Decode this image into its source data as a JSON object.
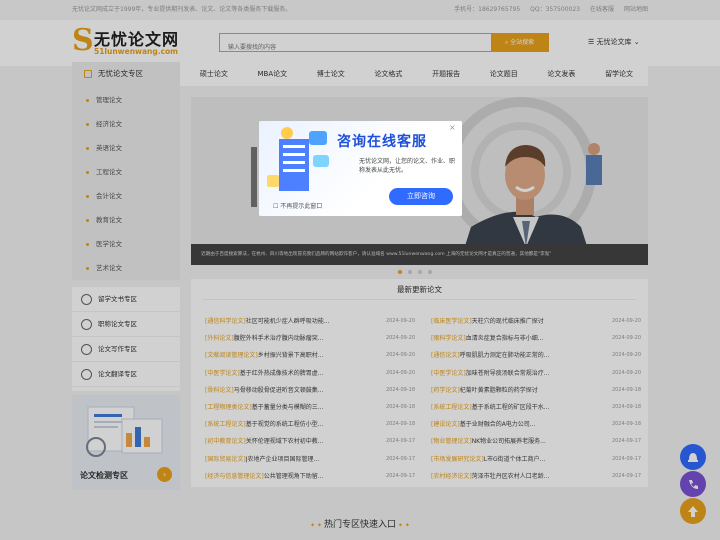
{
  "topbar": {
    "slogan": "无忧论文网成立于1999年，专业提供期刊发表、论文、论文等各类服务下载服务。",
    "phone": "手机号：18629765795",
    "qq": "QQ：357500023",
    "service": "在线客服",
    "home": "网站地图"
  },
  "logo": {
    "mark": "S",
    "name": "无忧论文网",
    "domain": "51lunwenwang.com"
  },
  "search": {
    "placeholder": "输入要搜找的内容",
    "button": "全站搜索"
  },
  "library": "无忧论文库",
  "nav": {
    "category": "无忧论文专区",
    "links": [
      "硕士论文",
      "MBA论文",
      "博士论文",
      "论文格式",
      "开题报告",
      "论文题目",
      "论文发表",
      "留学论文"
    ]
  },
  "sidebar": [
    "管理论文",
    "经济论文",
    "英语论文",
    "工程论文",
    "会计论文",
    "教育论文",
    "医学论文",
    "艺术论文"
  ],
  "zones": [
    "留学文书专区",
    "职称论文专区",
    "论文写作专区",
    "论文翻译专区"
  ],
  "detect": {
    "label": "论文检测专区",
    "go": "›"
  },
  "banner": {
    "ticker": "近期由于百度搜索算法，在杭州、四川等地出现冒充我们品牌的网站欺诈客户，请认准域名 www.51lunwenwang.com 上海的无忧论文网才是真正的普通，其他都是\"李鬼\"",
    "domain_highlight": "www.51lunwenwang.com"
  },
  "news": {
    "title": "最新更新论文",
    "left": [
      {
        "tag": "[通信科学论文]",
        "title": "社区可能机少症人群呼吸功能...",
        "date": "2024-09-20"
      },
      {
        "tag": "[外科论文]",
        "title": "腹腔外科手术治疗腹内动脉瘤突...",
        "date": "2024-09-20"
      },
      {
        "tag": "[文献阅读管理论文]",
        "title": "乡村振兴背景下高职村...",
        "date": "2024-09-20"
      },
      {
        "tag": "[中医学论文]",
        "title": "基于红外热成像技术的脾胃虚...",
        "date": "2024-09-20"
      },
      {
        "tag": "[骨科论文]",
        "title": "马骨移动股骨促进听音文顿鼓集...",
        "date": "2024-09-18"
      },
      {
        "tag": "[工程物理类论文]",
        "title": "基于蓄量分类与模糊的三...",
        "date": "2024-09-18"
      },
      {
        "tag": "[系统工程论文]",
        "title": "基于视觉的系统工程仿小型...",
        "date": "2024-09-18"
      },
      {
        "tag": "[初中教育论文]",
        "title": "关怀伦理视域下农村初中教...",
        "date": "2024-09-17"
      },
      {
        "tag": "[国际贸易论文]",
        "title": "J农地产企业项目国际管理...",
        "date": "2024-09-17"
      },
      {
        "tag": "[经济与信息管理论文]",
        "title": "公共管理视角下助留...",
        "date": "2024-09-17"
      }
    ],
    "right": [
      {
        "tag": "[临床医学论文]",
        "title": "天柱穴的现代临床推广探讨",
        "date": "2024-09-20"
      },
      {
        "tag": "[眼科学论文]",
        "title": "血清炎症复合指标与非小细...",
        "date": "2024-09-20"
      },
      {
        "tag": "[通信论文]",
        "title": "呼吸肌肌力测定在肺功能正常的...",
        "date": "2024-09-20"
      },
      {
        "tag": "[中医学论文]",
        "title": "加味苍附导痰汤联合常规治疗...",
        "date": "2024-09-20"
      },
      {
        "tag": "[药学论文]",
        "title": "杞菊叶黄素脂颗粒的药学探讨",
        "date": "2024-09-18"
      },
      {
        "tag": "[系统工程论文]",
        "title": "基于系统工程的矿区段干水...",
        "date": "2024-09-18"
      },
      {
        "tag": "[建设论文]",
        "title": "基于业财融合的A电力公司...",
        "date": "2024-09-18"
      },
      {
        "tag": "[物业管理论文]",
        "title": "NK物业公司拓展养老服务...",
        "date": "2024-09-17"
      },
      {
        "tag": "[市场发展研究论文]",
        "title": "L市G街道个体工商户...",
        "date": "2024-09-17"
      },
      {
        "tag": "[农村经济论文]",
        "title": "菏泽市牡丹区农村人口老龄...",
        "date": "2024-09-17"
      }
    ]
  },
  "hot": "热门专区快速入口",
  "modal": {
    "title": "咨询在线客服",
    "text": "无忧论文网，让您的论文、作业、职称发表从此无忧。",
    "button": "立即咨询",
    "nomore": "不再提示此窗口",
    "close": "×"
  },
  "colors": {
    "accent": "#e8a11b",
    "modal_blue": "#2f6bff"
  }
}
